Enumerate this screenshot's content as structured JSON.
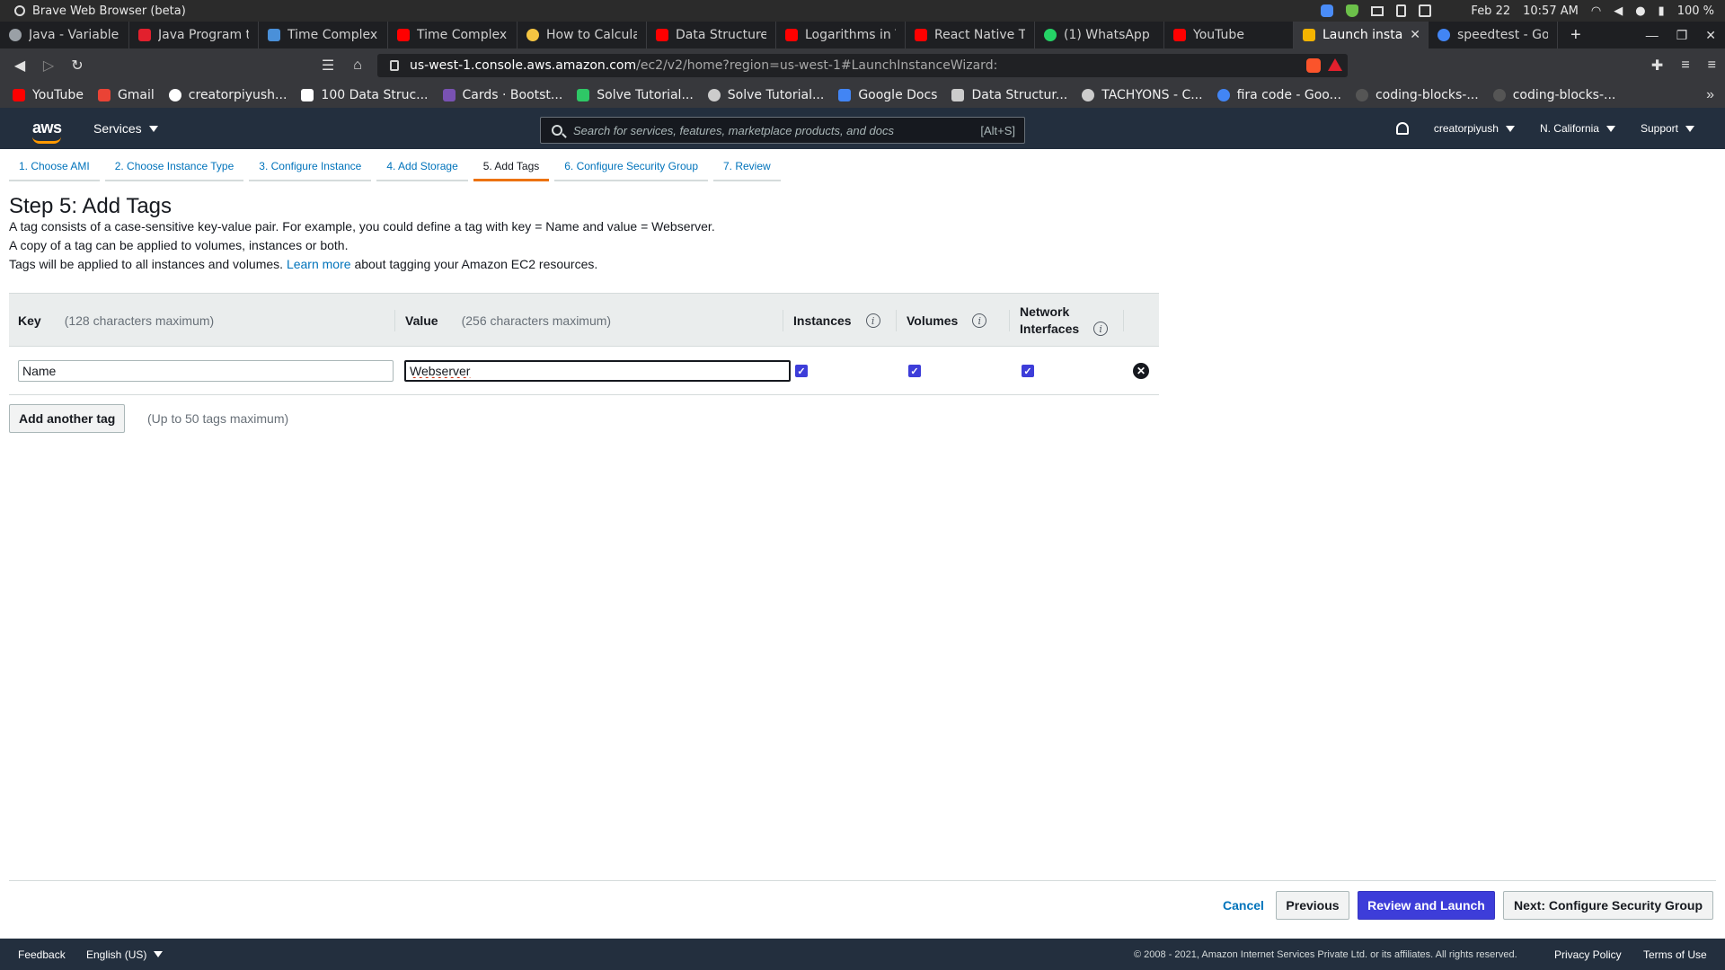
{
  "os": {
    "window_title": "Brave Web Browser (beta)",
    "date": "Feb 22",
    "time": "10:57 AM",
    "battery": "100 %"
  },
  "tabs": [
    {
      "label": "Java - Variable T",
      "icon": "page-icon",
      "color": "#9aa0a6"
    },
    {
      "label": "Java Program t",
      "icon": "t-logo-icon",
      "color": "#e2202d"
    },
    {
      "label": "Time Complexit",
      "icon": "ib-logo-icon",
      "color": "#4a90d9"
    },
    {
      "label": "Time Complexit",
      "icon": "youtube-icon",
      "color": "#ff0000"
    },
    {
      "label": "How to Calculat",
      "icon": "page-icon",
      "color": "#f5c542"
    },
    {
      "label": "Data Structures",
      "icon": "youtube-icon",
      "color": "#ff0000"
    },
    {
      "label": "Logarithms in T",
      "icon": "youtube-icon",
      "color": "#ff0000"
    },
    {
      "label": "React Native Tu",
      "icon": "youtube-icon",
      "color": "#ff0000"
    },
    {
      "label": "(1) WhatsApp",
      "icon": "whatsapp-icon",
      "color": "#25d366"
    },
    {
      "label": "YouTube",
      "icon": "youtube-icon",
      "color": "#ff0000"
    },
    {
      "label": "Launch insta",
      "icon": "aws-cube-icon",
      "color": "#f5b400",
      "active": true
    },
    {
      "label": "speedtest - Goo",
      "icon": "google-icon",
      "color": "#4285f4"
    }
  ],
  "address": {
    "host": "us-west-1.console.aws.amazon.com",
    "path": "/ec2/v2/home?region=us-west-1#LaunchInstanceWizard:"
  },
  "bookmarks": [
    {
      "label": "YouTube",
      "color": "#ff0000"
    },
    {
      "label": "Gmail",
      "color": "#ea4335"
    },
    {
      "label": "creatorpiyush...",
      "color": "#ffffff"
    },
    {
      "label": "100 Data Struc...",
      "color": "#ffffff"
    },
    {
      "label": "Cards · Bootst...",
      "color": "#7952b3"
    },
    {
      "label": "Solve Tutorial...",
      "color": "#2ec866"
    },
    {
      "label": "Solve Tutorial...",
      "color": "#cccccc"
    },
    {
      "label": "Google Docs",
      "color": "#4285f4"
    },
    {
      "label": "Data Structur...",
      "color": "#cccccc"
    },
    {
      "label": "TACHYONS - C...",
      "color": "#cccccc"
    },
    {
      "label": "fira code - Goo...",
      "color": "#4285f4"
    },
    {
      "label": "coding-blocks-...",
      "color": "#555555"
    },
    {
      "label": "coding-blocks-...",
      "color": "#555555"
    }
  ],
  "aws": {
    "logo": "aws",
    "services": "Services",
    "search_placeholder": "Search for services, features, marketplace products, and docs",
    "search_shortcut": "[Alt+S]",
    "user": "creatorpiyush",
    "region": "N. California",
    "support": "Support"
  },
  "wizard": {
    "steps": [
      "1. Choose AMI",
      "2. Choose Instance Type",
      "3. Configure Instance",
      "4. Add Storage",
      "5. Add Tags",
      "6. Configure Security Group",
      "7. Review"
    ],
    "active_step": 4
  },
  "page": {
    "title": "Step 5: Add Tags",
    "desc1": "A tag consists of a case-sensitive key-value pair. For example, you could define a tag with key = Name and value = Webserver.",
    "desc2": "A copy of a tag can be applied to volumes, instances or both.",
    "desc3_pre": "Tags will be applied to all instances and volumes.",
    "desc3_link": "Learn more",
    "desc3_post": "about tagging your Amazon EC2 resources."
  },
  "table": {
    "key_header": "Key",
    "key_hint": "(128 characters maximum)",
    "value_header": "Value",
    "value_hint": "(256 characters maximum)",
    "instances_header": "Instances",
    "volumes_header": "Volumes",
    "network_header_1": "Network",
    "network_header_2": "Interfaces",
    "rows": [
      {
        "key": "Name",
        "value": "Webserver",
        "instances": true,
        "volumes": true,
        "network_interfaces": true
      }
    ]
  },
  "add_tag": {
    "button": "Add another tag",
    "hint": "(Up to 50 tags maximum)"
  },
  "actions": {
    "cancel": "Cancel",
    "previous": "Previous",
    "review": "Review and Launch",
    "next": "Next: Configure Security Group"
  },
  "footer": {
    "feedback": "Feedback",
    "language": "English (US)",
    "copyright": "© 2008 - 2021, Amazon Internet Services Private Ltd. or its affiliates. All rights reserved.",
    "privacy": "Privacy Policy",
    "terms": "Terms of Use"
  }
}
